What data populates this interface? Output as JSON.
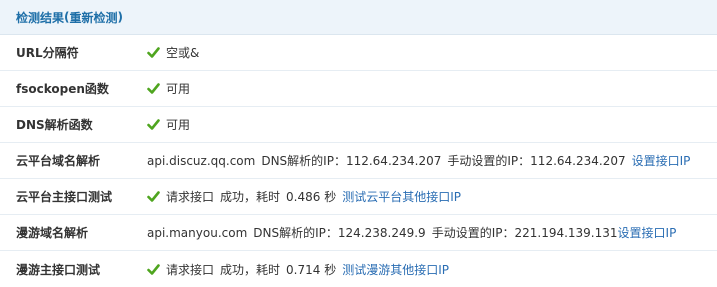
{
  "header": {
    "title": "检测结果",
    "paren_open": "(",
    "recheck_link": "重新检测",
    "paren_close": ")"
  },
  "icons": {
    "check": "check-icon",
    "check_color": "#4fa51f"
  },
  "rows": [
    {
      "label": "URL分隔符",
      "status": "空或&"
    },
    {
      "label": "fsockopen函数",
      "status": "可用"
    },
    {
      "label": "DNS解析函数",
      "status": "可用"
    },
    {
      "label": "云平台域名解析",
      "domain": "api.discuz.qq.com",
      "dns_label": "DNS解析的IP：",
      "dns_ip": "112.64.234.207",
      "manual_label": "手动设置的IP：",
      "manual_ip": "112.64.234.207",
      "link": "设置接口IP"
    },
    {
      "label": "云平台主接口测试",
      "request": "请求接口",
      "result": "成功，耗时",
      "time": "0.486 秒",
      "link": "测试云平台其他接口IP"
    },
    {
      "label": "漫游域名解析",
      "domain": "api.manyou.com",
      "dns_label": "DNS解析的IP：",
      "dns_ip": "124.238.249.9",
      "manual_label": "手动设置的IP：",
      "manual_ip": "221.194.139.131",
      "link": "设置接口IP"
    },
    {
      "label": "漫游主接口测试",
      "request": "请求接口",
      "result": "成功，耗时",
      "time": "0.714 秒",
      "link": "测试漫游其他接口IP"
    }
  ]
}
